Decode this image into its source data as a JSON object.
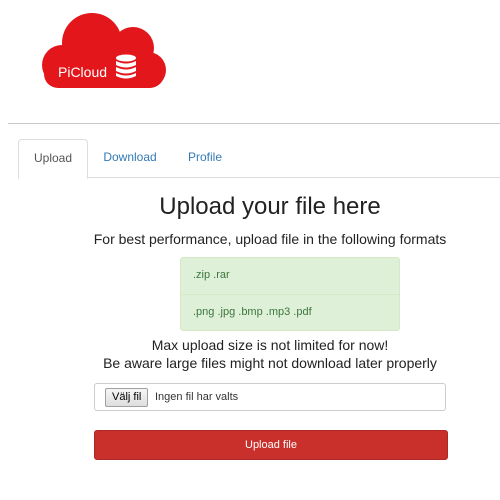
{
  "brand": {
    "name": "PiCloud",
    "logo_color": "#e3161b"
  },
  "tabs": [
    {
      "label": "Upload",
      "active": true
    },
    {
      "label": "Download",
      "active": false
    },
    {
      "label": "Profile",
      "active": false
    }
  ],
  "main": {
    "title": "Upload your file here",
    "subtitle": "For best performance, upload file in the following formats",
    "formats": [
      ".zip .rar",
      ".png .jpg .bmp .mp3 .pdf"
    ],
    "note_line1": "Max upload size is not limited for now!",
    "note_line2": "Be aware large files might not download later properly"
  },
  "file_input": {
    "button_label": "Välj fil",
    "status": "Ingen fil har valts"
  },
  "upload_button": {
    "label": "Upload file",
    "color": "#c9302c"
  },
  "colors": {
    "accent": "#337ab7",
    "success_bg": "#dff0d8",
    "success_text": "#3c763d"
  }
}
